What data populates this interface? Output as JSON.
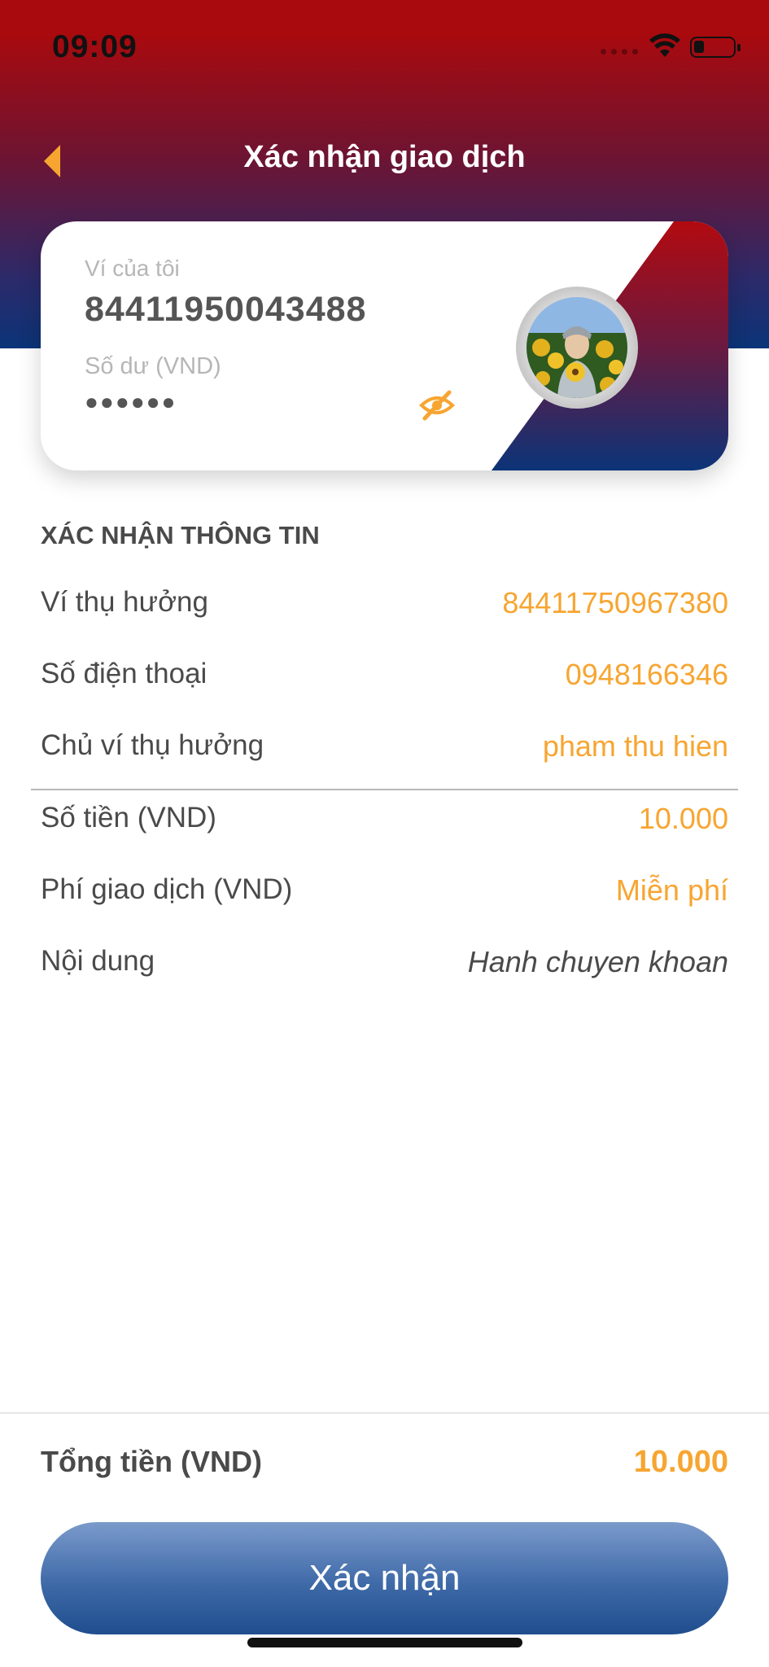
{
  "status_bar": {
    "time": "09:09"
  },
  "header": {
    "title": "Xác nhận giao dịch"
  },
  "wallet_card": {
    "label": "Ví của tôi",
    "number": "84411950043488",
    "balance_label": "Số dư (VND)",
    "balance_hidden": "●●●●●●"
  },
  "confirm_section": {
    "title": "XÁC NHẬN THÔNG TIN",
    "rows": [
      {
        "label": "Ví thụ hưởng",
        "value": "84411750967380"
      },
      {
        "label": "Số điện thoại",
        "value": "0948166346"
      },
      {
        "label": "Chủ ví thụ hưởng",
        "value": "pham thu hien"
      },
      {
        "label": "Số tiền (VND)",
        "value": "10.000"
      },
      {
        "label": "Phí giao dịch (VND)",
        "value": "Miễn phí"
      },
      {
        "label": "Nội dung",
        "value": "Hanh chuyen khoan"
      }
    ]
  },
  "total": {
    "label": "Tổng tiền (VND)",
    "value": "10.000"
  },
  "actions": {
    "confirm_label": "Xác nhận"
  },
  "colors": {
    "accent": "#f7a531",
    "header_red": "#a80a0e",
    "header_blue": "#0b3478",
    "button_blue": "#3f6aa8"
  },
  "icons": [
    "back-arrow-icon",
    "wifi-icon",
    "battery-icon",
    "eye-slash-icon",
    "avatar"
  ]
}
